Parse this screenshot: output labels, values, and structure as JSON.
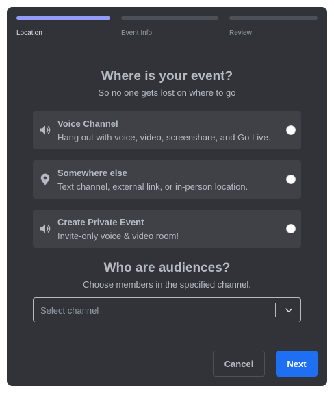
{
  "stepper": {
    "steps": [
      {
        "label": "Location",
        "active": true
      },
      {
        "label": "Event Info",
        "active": false
      },
      {
        "label": "Review",
        "active": false
      }
    ]
  },
  "location": {
    "title": "Where is your event?",
    "subtitle": "So no one gets lost on where to go",
    "options": [
      {
        "title": "Voice Channel",
        "description": "Hang out with voice, video, screenshare, and Go Live.",
        "icon": "speaker-icon",
        "selected": false
      },
      {
        "title": "Somewhere else",
        "description": "Text channel, external link, or in-person location.",
        "icon": "location-pin-icon",
        "selected": false
      },
      {
        "title": "Create Private Event",
        "description": "Invite-only voice & video room!",
        "icon": "speaker-icon",
        "selected": false
      }
    ]
  },
  "audience": {
    "title": "Who are audiences?",
    "subtitle": "Choose members in the specified channel.",
    "select_placeholder": "Select channel"
  },
  "footer": {
    "cancel_label": "Cancel",
    "next_label": "Next"
  },
  "colors": {
    "background": "#313338",
    "option_bg": "#3f4147",
    "accent_step": "#949cf7",
    "primary_button": "#1e6ff2",
    "text": "#b5bac1"
  }
}
